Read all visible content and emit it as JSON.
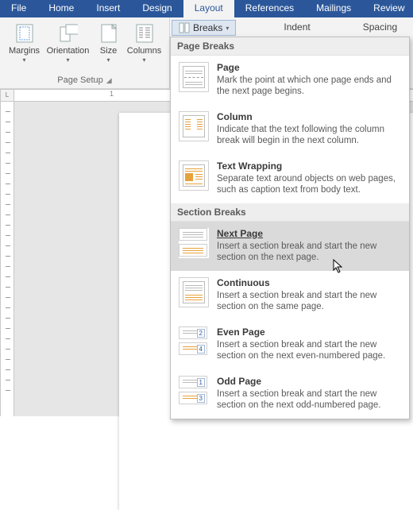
{
  "tabs": {
    "file": "File",
    "home": "Home",
    "insert": "Insert",
    "design": "Design",
    "layout": "Layout",
    "references": "References",
    "mailings": "Mailings",
    "review": "Review"
  },
  "ribbon": {
    "margins": "Margins",
    "orientation": "Orientation",
    "size": "Size",
    "columns": "Columns",
    "page_setup": "Page Setup",
    "breaks": "Breaks",
    "indent": "Indent",
    "spacing": "Spacing"
  },
  "ruler": {
    "corner": "L",
    "h_marks": "1"
  },
  "dropdown": {
    "header_page": "Page Breaks",
    "header_section": "Section Breaks",
    "page": {
      "title": "Page",
      "desc": "Mark the point at which one page ends and the next page begins."
    },
    "column": {
      "title": "Column",
      "desc": "Indicate that the text following the column break will begin in the next column."
    },
    "text_wrapping": {
      "title": "Text Wrapping",
      "desc": "Separate text around objects on web pages, such as caption text from body text."
    },
    "next_page": {
      "title": "Next Page",
      "desc": "Insert a section break and start the new section on the next page."
    },
    "continuous": {
      "title": "Continuous",
      "desc": "Insert a section break and start the new section on the same page."
    },
    "even_page": {
      "title": "Even Page",
      "desc": "Insert a section break and start the new section on the next even-numbered page."
    },
    "odd_page": {
      "title": "Odd Page",
      "desc": "Insert a section break and start the new section on the next odd-numbered page."
    }
  }
}
